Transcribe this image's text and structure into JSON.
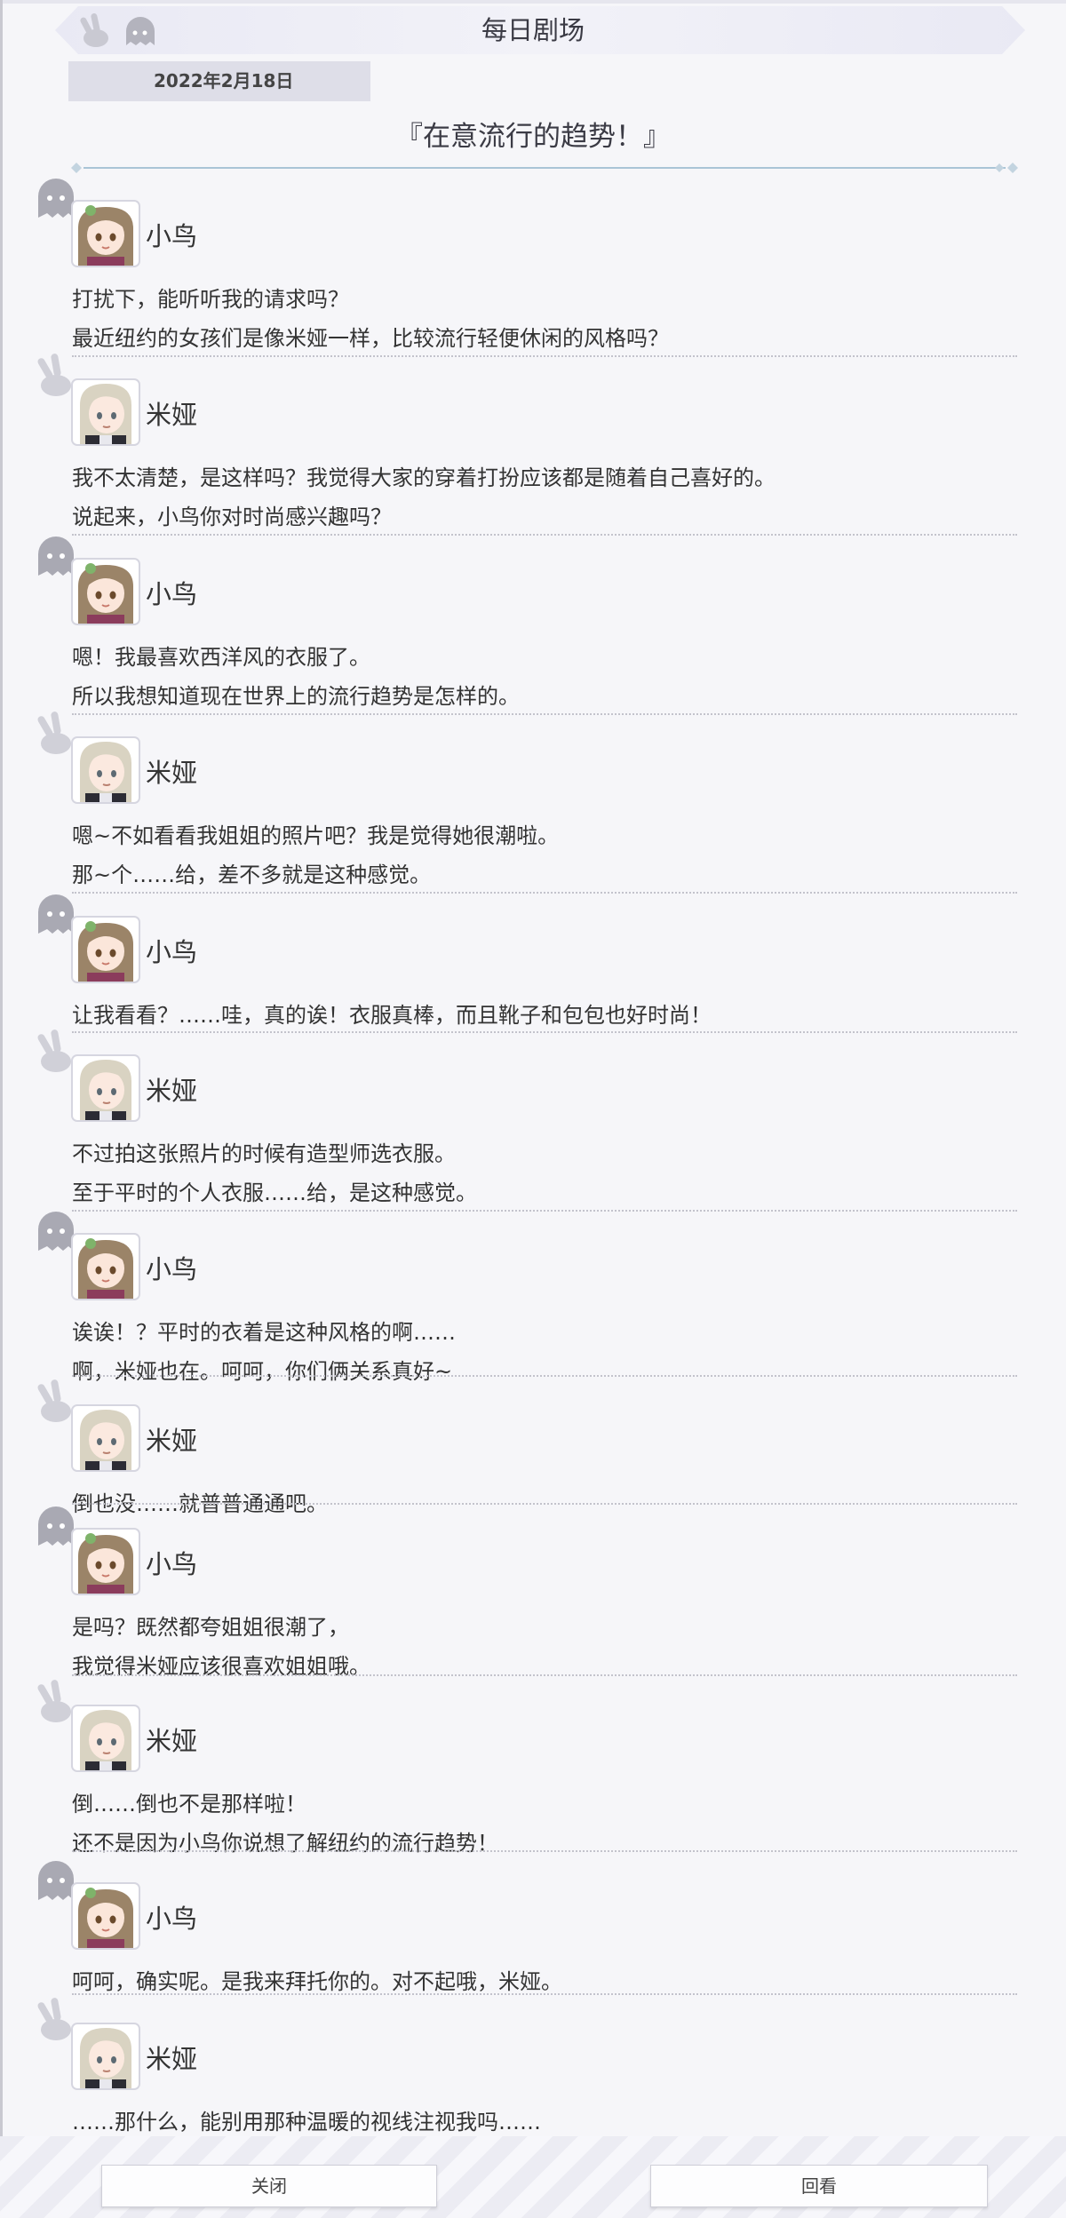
{
  "header": {
    "title": "每日剧场",
    "icons": [
      "peace-hand-icon",
      "ghost-icon"
    ]
  },
  "date": "2022年2月18日",
  "story_title": "『在意流行的趋势！』",
  "dialogues": [
    {
      "speaker": "小鸟",
      "lines": [
        "打扰下，能听听我的请求吗？",
        "最近纽约的女孩们是像米娅一样，比较流行轻便休闲的风格吗？"
      ]
    },
    {
      "speaker": "米娅",
      "lines": [
        "我不太清楚，是这样吗？我觉得大家的穿着打扮应该都是随着自己喜好的。",
        "说起来，小鸟你对时尚感兴趣吗？"
      ]
    },
    {
      "speaker": "小鸟",
      "lines": [
        "嗯！我最喜欢西洋风的衣服了。",
        "所以我想知道现在世界上的流行趋势是怎样的。"
      ]
    },
    {
      "speaker": "米娅",
      "lines": [
        "嗯~不如看看我姐姐的照片吧？我是觉得她很潮啦。",
        "那~个……给，差不多就是这种感觉。"
      ]
    },
    {
      "speaker": "小鸟",
      "lines": [
        "让我看看？……哇，真的诶！衣服真棒，而且靴子和包包也好时尚！"
      ]
    },
    {
      "speaker": "米娅",
      "lines": [
        "不过拍这张照片的时候有造型师选衣服。",
        "至于平时的个人衣服……给，是这种感觉。"
      ]
    },
    {
      "speaker": "小鸟",
      "lines": [
        "诶诶！？平时的衣着是这种风格的啊……",
        "啊，米娅也在。呵呵，你们俩关系真好~"
      ]
    },
    {
      "speaker": "米娅",
      "lines": [
        "倒也没……就普普通通吧。"
      ]
    },
    {
      "speaker": "小鸟",
      "lines": [
        "是吗？既然都夸姐姐很潮了，",
        "我觉得米娅应该很喜欢姐姐哦。"
      ]
    },
    {
      "speaker": "米娅",
      "lines": [
        "倒……倒也不是那样啦！",
        "还不是因为小鸟你说想了解纽约的流行趋势！"
      ]
    },
    {
      "speaker": "小鸟",
      "lines": [
        "呵呵，确实呢。是我来拜托你的。对不起哦，米娅。"
      ]
    },
    {
      "speaker": "米娅",
      "lines": [
        "……那什么，能别用那种温暖的视线注视我吗……"
      ]
    }
  ],
  "footer": {
    "close_label": "关闭",
    "review_label": "回看"
  },
  "colors": {
    "accent": "#aac4d6",
    "kotori_hair": "#9b8468",
    "mia_hair": "#d9d3c2"
  }
}
